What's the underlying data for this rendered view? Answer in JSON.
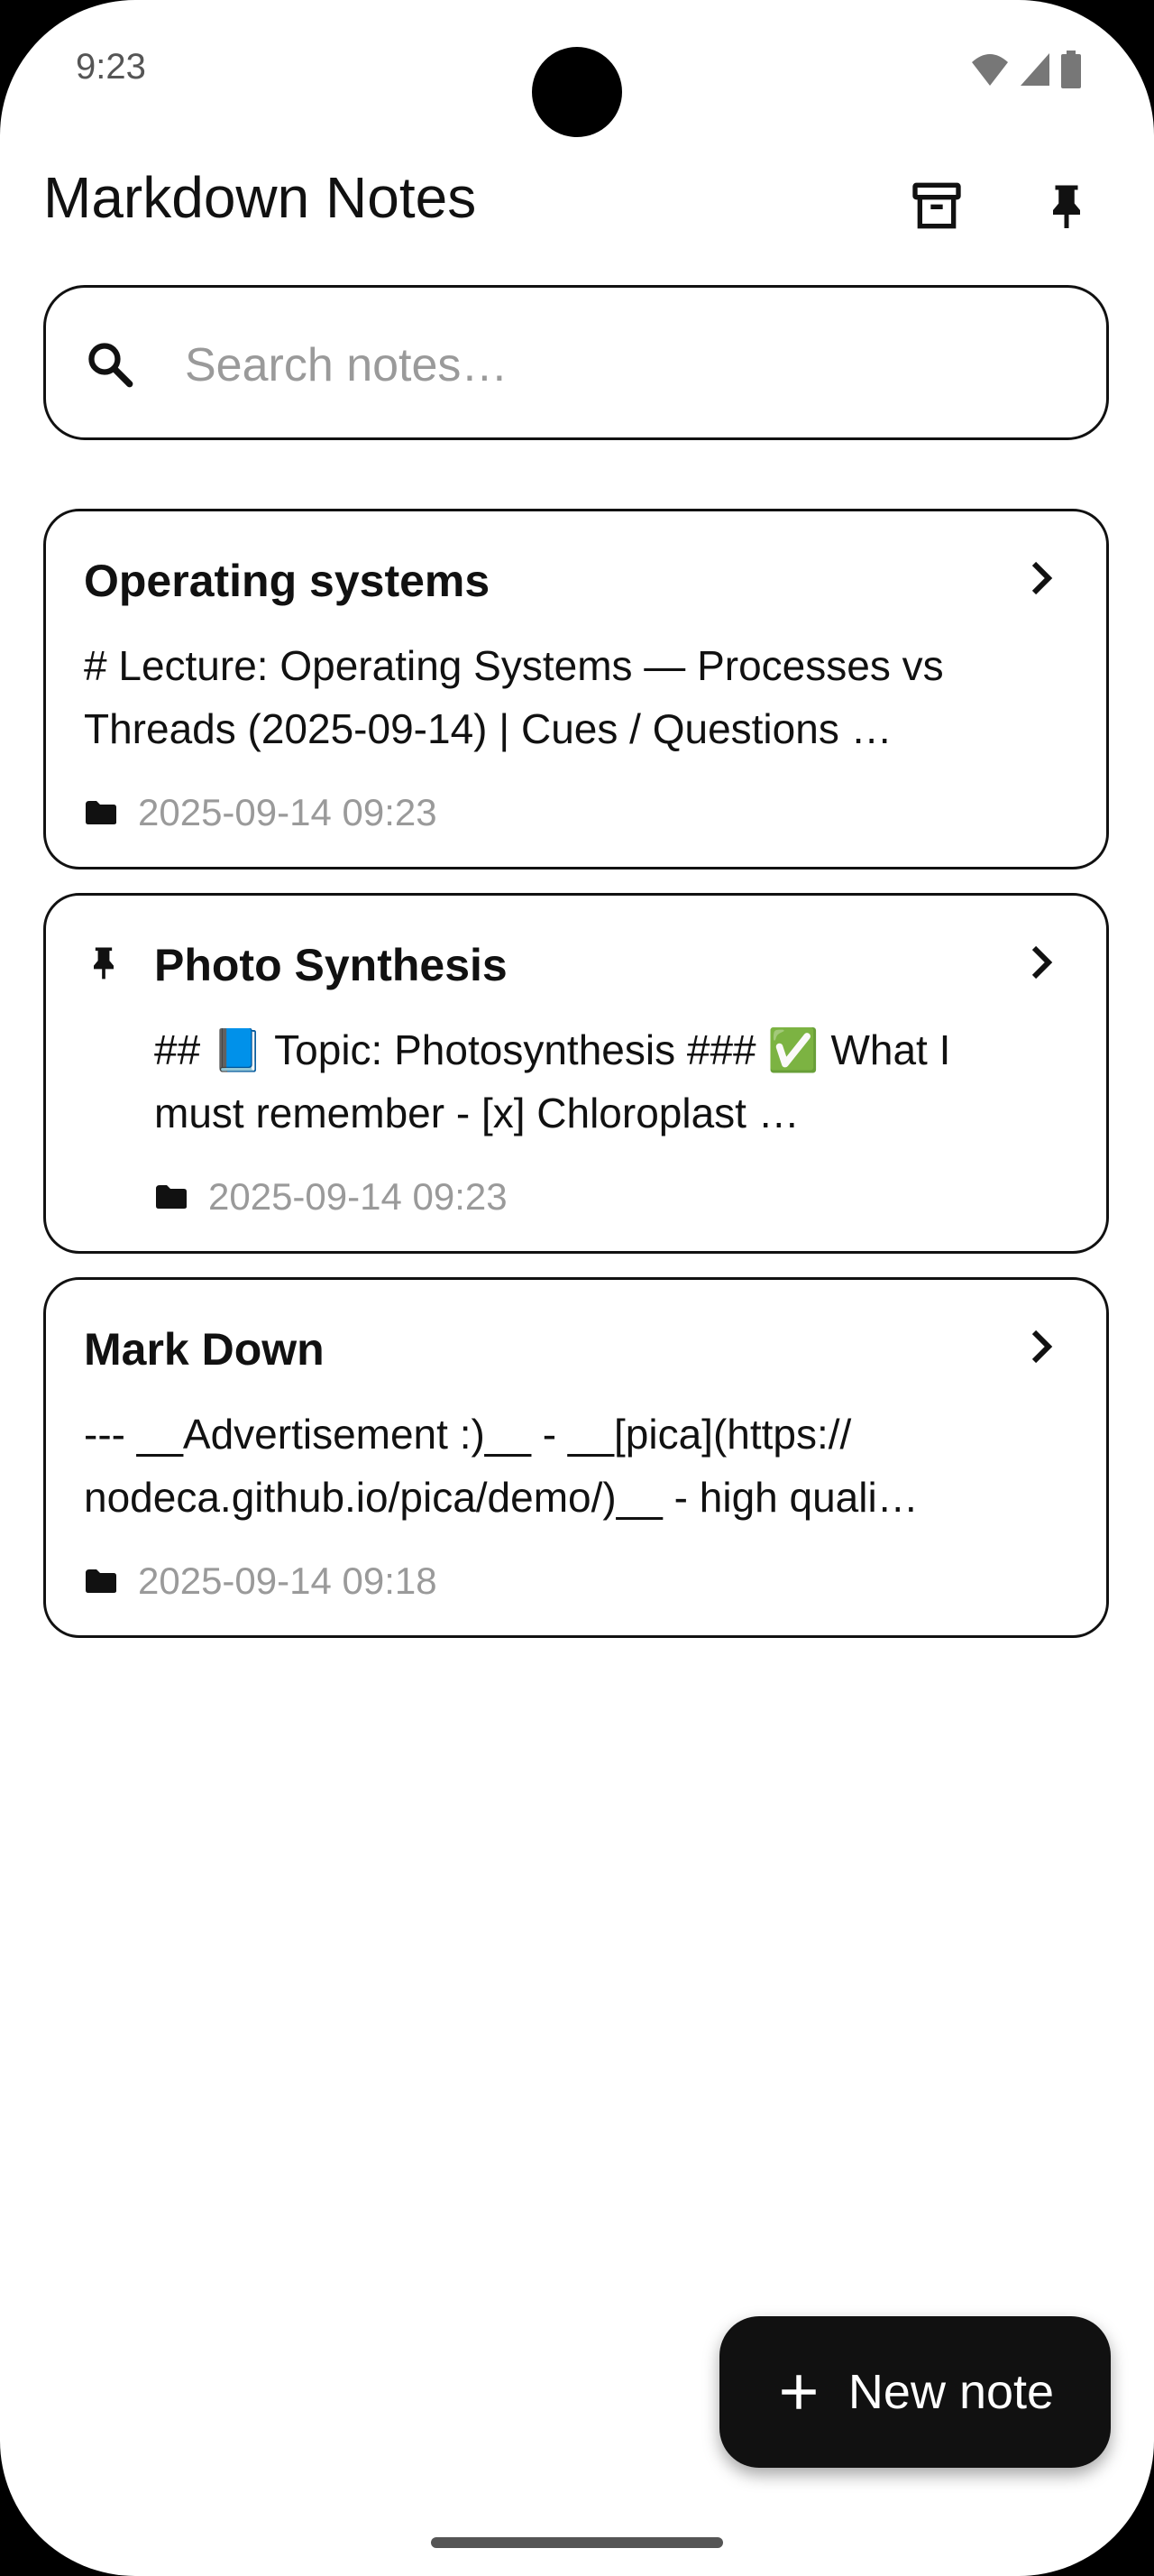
{
  "status_bar": {
    "time": "9:23"
  },
  "app_bar": {
    "title": "Markdown Notes"
  },
  "search": {
    "placeholder": "Search notes…"
  },
  "notes": [
    {
      "title": "Operating systems",
      "preview": "# Lecture: Operating Systems — Processes vs Threads (2025-09-14)      | Cues / Questions …",
      "date": "2025-09-14 09:23",
      "pinned": false
    },
    {
      "title": "Photo Synthesis",
      "preview": "## 📘 Topic: Photosynthesis    ### ✅ What I must remember  - [x] Chloroplast …",
      "date": "2025-09-14 09:23",
      "pinned": true
    },
    {
      "title": "Mark Down",
      "preview": "---  __Advertisement :)__    - __[pica](https:// nodeca.github.io/pica/demo/)__ - high quali…",
      "date": "2025-09-14 09:18",
      "pinned": false
    }
  ],
  "fab": {
    "label": "New note",
    "icon": "plus-icon"
  },
  "icons": [
    "search-icon",
    "archive-icon",
    "pin-icon",
    "chevron-right-icon",
    "label-icon",
    "wifi-icon",
    "signal-icon",
    "battery-icon"
  ]
}
